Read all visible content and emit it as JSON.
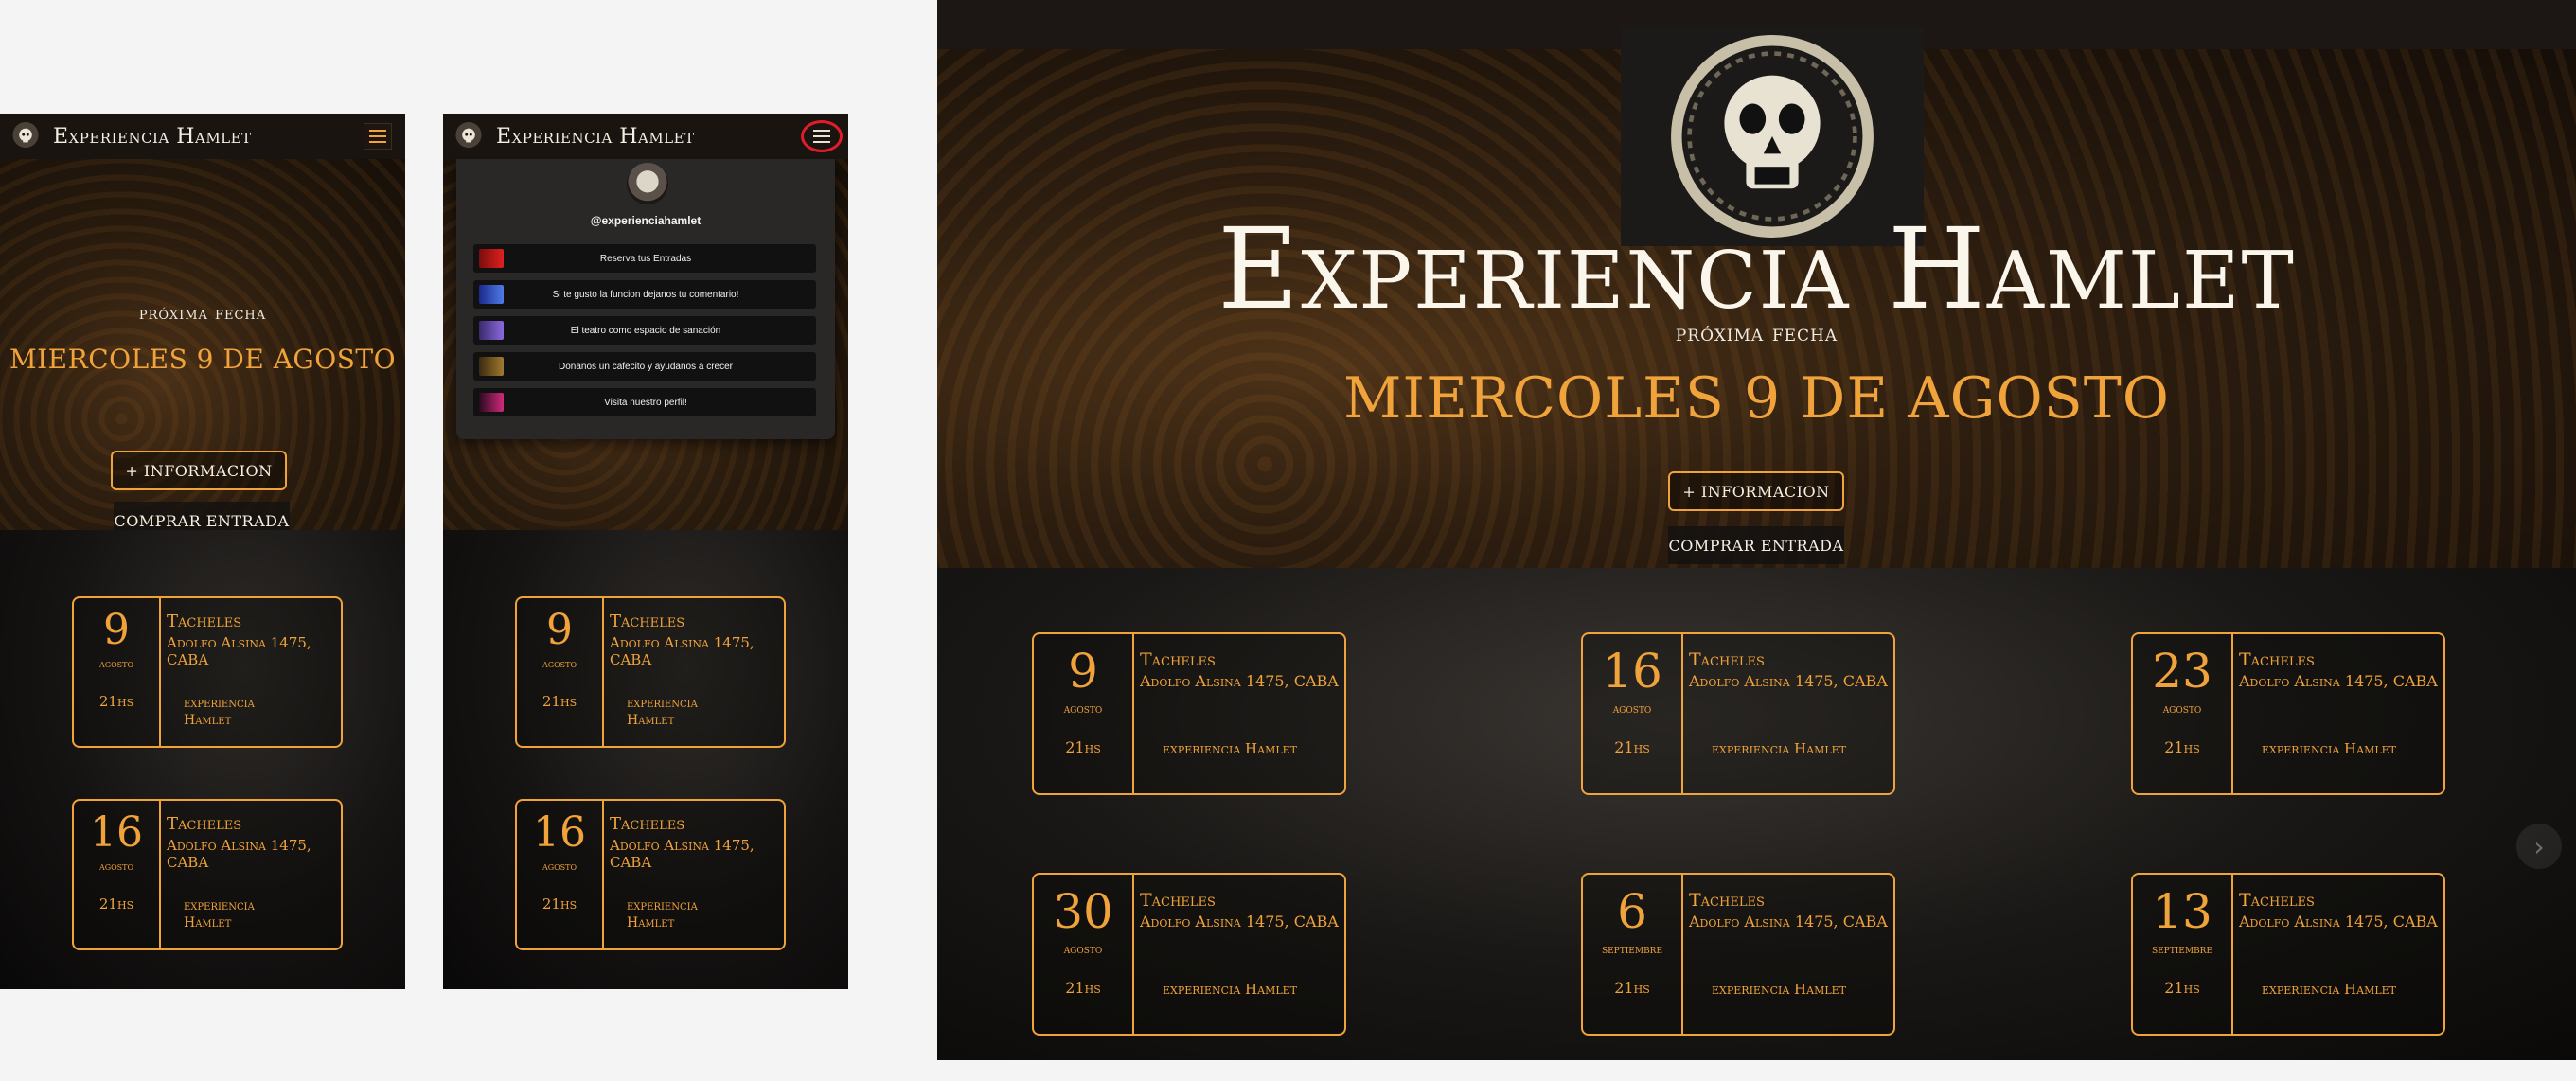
{
  "brand": "Experiencia Hamlet",
  "hero": {
    "next_label": "próxima fecha",
    "next_date": "MIERCOLES 9 DE AGOSTO",
    "info_button": "+ INFORMACION",
    "buy_button": "COMPRAR ENTRADA"
  },
  "social": {
    "handle": "@experienciahamlet",
    "links": [
      {
        "label": "Reserva tus Entradas"
      },
      {
        "label": "Si te gusto la funcion dejanos tu comentario!"
      },
      {
        "label": "El teatro como espacio de sanación"
      },
      {
        "label": "Donanos un cafecito y ayudanos a crecer"
      },
      {
        "label": "Visita nuestro perfil!"
      }
    ]
  },
  "events": [
    {
      "day": "9",
      "month": "agosto",
      "time": "21hs",
      "venue": "Tacheles",
      "address": "Adolfo Alsina 1475, CABA",
      "show": "experiencia Hamlet"
    },
    {
      "day": "16",
      "month": "agosto",
      "time": "21hs",
      "venue": "Tacheles",
      "address": "Adolfo Alsina 1475, CABA",
      "show": "experiencia Hamlet"
    },
    {
      "day": "23",
      "month": "agosto",
      "time": "21hs",
      "venue": "Tacheles",
      "address": "Adolfo Alsina 1475, CABA",
      "show": "experiencia Hamlet"
    },
    {
      "day": "30",
      "month": "agosto",
      "time": "21hs",
      "venue": "Tacheles",
      "address": "Adolfo Alsina 1475, CABA",
      "show": "experiencia Hamlet"
    },
    {
      "day": "6",
      "month": "septiembre",
      "time": "21hs",
      "venue": "Tacheles",
      "address": "Adolfo Alsina 1475, CABA",
      "show": "experiencia Hamlet"
    },
    {
      "day": "13",
      "month": "septiembre",
      "time": "21hs",
      "venue": "Tacheles",
      "address": "Adolfo Alsina 1475, CABA",
      "show": "experiencia Hamlet"
    }
  ],
  "icons": {
    "menu": "hamburger-menu-icon",
    "logo": "skull-logo-icon",
    "next": "chevron-right-icon"
  },
  "colors": {
    "accent": "#f0a23b",
    "text_light": "#f5efe4",
    "background": "#0c0b0a",
    "highlight_circle": "#e01c2a"
  }
}
